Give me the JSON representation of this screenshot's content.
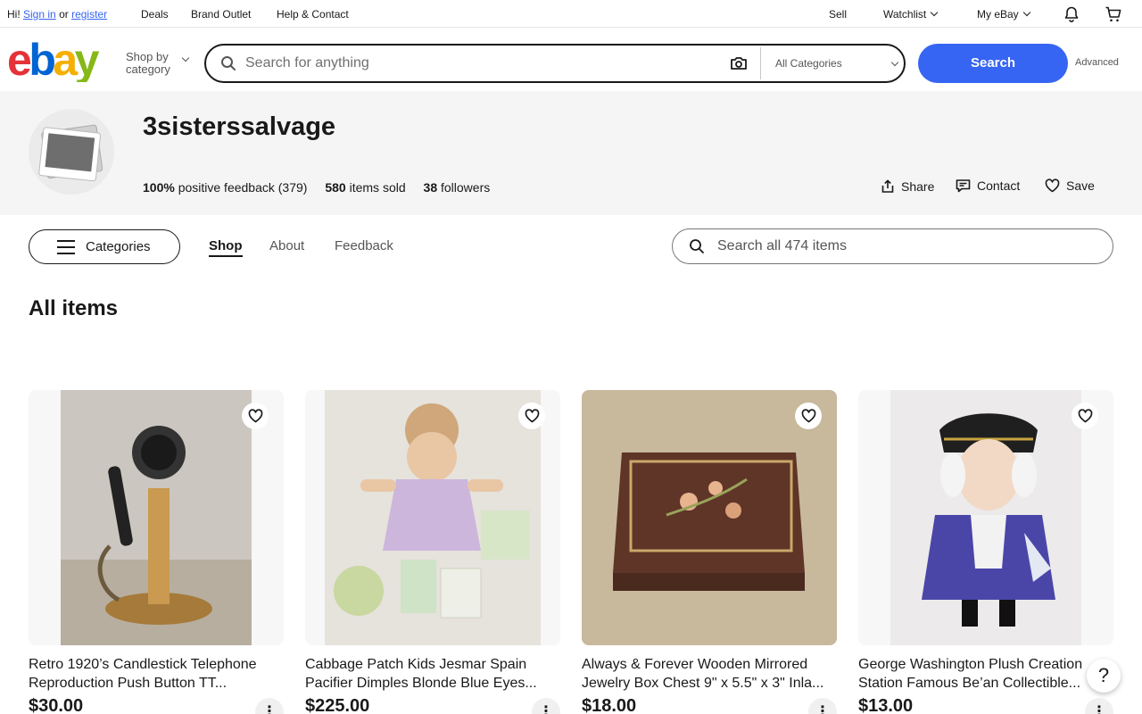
{
  "topbar": {
    "greeting": "Hi!",
    "sign_in": "Sign in",
    "or": "or",
    "register": "register",
    "deals": "Deals",
    "brand_outlet": "Brand Outlet",
    "help": "Help & Contact",
    "sell": "Sell",
    "watchlist": "Watchlist",
    "my_ebay": "My eBay"
  },
  "header": {
    "shop_by_line1": "Shop by",
    "shop_by_line2": "category",
    "search_placeholder": "Search for anything",
    "category_select": "All Categories",
    "search_button": "Search",
    "advanced": "Advanced"
  },
  "store": {
    "name": "3sisterssalvage",
    "feedback_pct": "100%",
    "feedback_text": "positive feedback (379)",
    "items_sold_count": "580",
    "items_sold_text": "items sold",
    "followers_count": "38",
    "followers_text": "followers",
    "share": "Share",
    "contact": "Contact",
    "save": "Save"
  },
  "store_nav": {
    "categories": "Categories",
    "tabs": [
      "Shop",
      "About",
      "Feedback"
    ],
    "search_placeholder": "Search all 474 items"
  },
  "section_title": "All items",
  "items": [
    {
      "title": "Retro 1920’s Candlestick Telephone Reproduction Push Button TT...",
      "price": "$30.00"
    },
    {
      "title": "Cabbage Patch Kids Jesmar Spain Pacifier Dimples Blonde Blue Eyes...",
      "price": "$225.00"
    },
    {
      "title": "Always & Forever Wooden Mirrored Jewelry Box Chest 9\" x 5.5\" x 3\" Inla...",
      "price": "$18.00"
    },
    {
      "title": "George Washington Plush Creation Station Famous Be’an Collectible...",
      "price": "$13.00"
    }
  ],
  "help": "?",
  "colors": {
    "accent": "#3665f3",
    "logo_e": "#e53238",
    "logo_b": "#0064d2",
    "logo_a": "#f5af02",
    "logo_y": "#86b817"
  }
}
